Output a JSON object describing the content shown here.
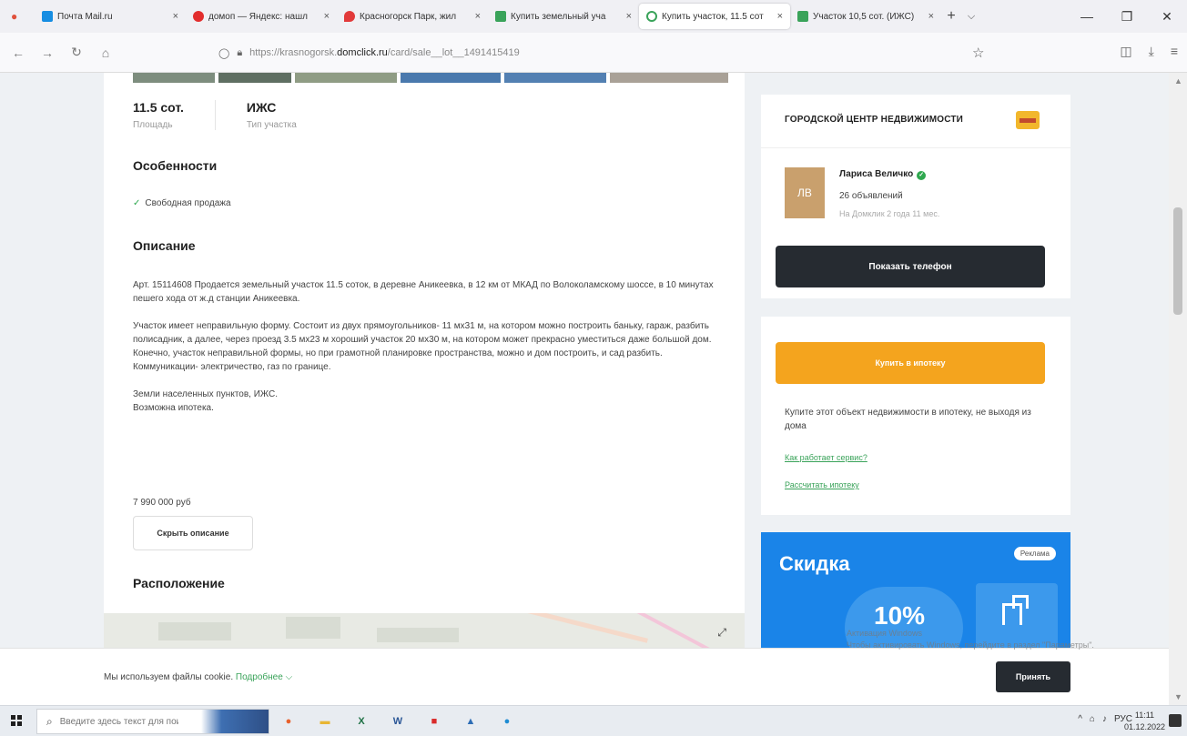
{
  "browser": {
    "tabs": [
      {
        "title": "Почта Mail.ru",
        "color": "#168de2",
        "active": false
      },
      {
        "title": "домоп — Яндекс: нашл",
        "color": "#e22d2d",
        "active": false
      },
      {
        "title": "Красногорск Парк, жил",
        "color": "#e23a3a",
        "active": false
      },
      {
        "title": "Купить земельный уча",
        "color": "#3aa35a",
        "active": false
      },
      {
        "title": "Купить участок, 11.5 сот",
        "color": "#3aa35a",
        "active": true
      },
      {
        "title": "Участок 10,5 сот. (ИЖС)",
        "color": "#3aa35a",
        "active": false
      }
    ],
    "url_prefix": "https://krasnogorsk.",
    "url_host": "domclick.ru",
    "url_path": "/card/sale__lot__1491415419"
  },
  "listing": {
    "facts": [
      {
        "value": "11.5 сот.",
        "label": "Площадь"
      },
      {
        "value": "ИЖС",
        "label": "Тип участка"
      }
    ],
    "features_title": "Особенности",
    "feature": "Свободная продажа",
    "description_title": "Описание",
    "description": [
      "Арт. 15114608 Продается земельный участок 11.5 соток, в деревне Аникеевка, в 12 км от МКАД по Волоколамскому шоссе, в 10 минутах пешего хода от ж.д станции Аникеевка.",
      "Участок имеет неправильную форму. Состоит из двух прямоугольников- 11 мх31 м, на котором можно построить баньку, гараж, разбить полисадник, а далее, через проезд 3.5 мх23 м хороший участок 20 мх30 м, на котором может прекрасно уместиться даже большой дом.\nКонечно, участок неправильной формы, но при грамотной планировке пространства, можно и дом построить, и сад разбить.\nКоммуникации- электричество, газ по границе.",
      "Земли населенных пунктов, ИЖС.\nВозможна ипотека."
    ],
    "price": "7 990 000 руб",
    "hide_button": "Скрыть описание",
    "location_title": "Расположение"
  },
  "agency": {
    "name": "ГОРОДСКОЙ ЦЕНТР НЕДВИЖИМОСТИ",
    "agent_initials": "ЛВ",
    "agent_name": "Лариса Величко",
    "agent_ads": "26 объявлений",
    "agent_since": "На Домклик 2 года 11 мес.",
    "phone_button": "Показать телефон"
  },
  "mortgage": {
    "button": "Купить в ипотеку",
    "text": "Купите этот объект недвижимости в ипотеку, не выходя из дома",
    "link1": "Как работает сервис?",
    "link2": "Рассчитать ипотеку"
  },
  "promo": {
    "title": "Скидка",
    "badge": "Реклама",
    "percent": "10%"
  },
  "cookie": {
    "text": "Мы используем файлы cookie.",
    "more": "Подробнее",
    "accept": "Принять"
  },
  "activation": "Активация Windows\nЧтобы активировать Windows, перейдите в раздел \"Параметры\".",
  "taskbar": {
    "search_placeholder": "Введите здесь текст для поиска",
    "lang": "РУС",
    "time": "11:11",
    "date": "01.12.2022"
  }
}
